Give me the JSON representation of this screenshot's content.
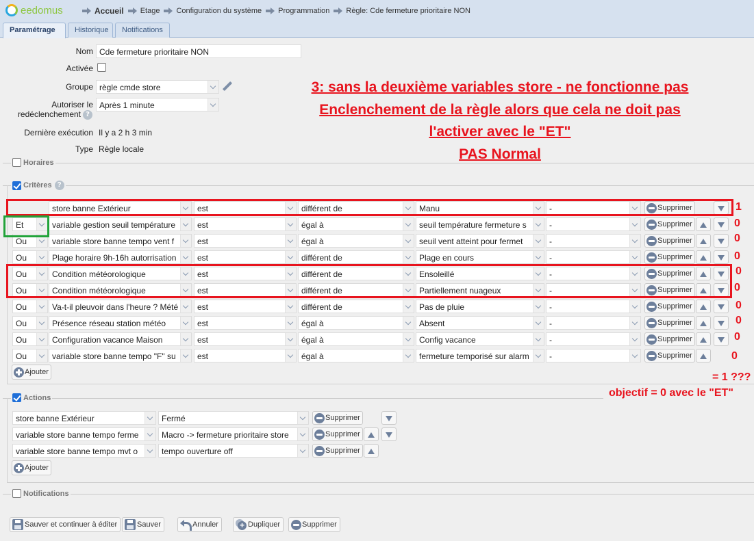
{
  "app": {
    "logo_text": "eedomus"
  },
  "breadcrumb": [
    {
      "label": "Accueil",
      "bold": true
    },
    {
      "label": "Etage"
    },
    {
      "label": "Configuration du système"
    },
    {
      "label": "Programmation"
    },
    {
      "label": "Règle: Cde fermeture prioritaire NON"
    }
  ],
  "tabs": [
    {
      "label": "Paramétrage",
      "active": true
    },
    {
      "label": "Historique"
    },
    {
      "label": "Notifications"
    }
  ],
  "form": {
    "nom_label": "Nom",
    "nom_value": "Cde fermeture prioritaire NON",
    "activee_label": "Activée",
    "activee_checked": false,
    "groupe_label": "Groupe",
    "groupe_value": "règle cmde store",
    "redecl_label_1": "Autoriser le",
    "redecl_label_2": "redéclenchement",
    "redecl_value": "Après 1 minute",
    "derniere_label": "Dernière exécution",
    "derniere_value": "Il y a 2 h 3 min",
    "type_label": "Type",
    "type_value": "Règle locale"
  },
  "sections": {
    "horaires": {
      "label": "Horaires",
      "checked": false
    },
    "criteres": {
      "label": "Critères",
      "checked": true
    },
    "actions": {
      "label": "Actions",
      "checked": true
    },
    "notifications": {
      "label": "Notifications",
      "checked": false
    }
  },
  "criteria": [
    {
      "logic": "",
      "device": "store banne Extérieur",
      "verb": "est",
      "op": "différent de",
      "value": "Manu",
      "extra": "-",
      "up": false,
      "down": true,
      "annotation": "1"
    },
    {
      "logic": "Et",
      "device": "variable gestion seuil température",
      "verb": "est",
      "op": "égal à",
      "value": "seuil température fermeture s",
      "extra": "-",
      "up": true,
      "down": true,
      "annotation": "0"
    },
    {
      "logic": "Ou",
      "device": "variable store banne tempo vent f",
      "verb": "est",
      "op": "égal à",
      "value": "seuil vent atteint pour fermet",
      "extra": "-",
      "up": true,
      "down": true,
      "annotation": "0"
    },
    {
      "logic": "Ou",
      "device": "Plage horaire 9h-16h autorrisation",
      "verb": "est",
      "op": "différent de",
      "value": "Plage en cours",
      "extra": "-",
      "up": true,
      "down": true,
      "annotation": "0"
    },
    {
      "logic": "Ou",
      "device": "Condition météorologique",
      "verb": "est",
      "op": "différent de",
      "value": "Ensoleillé",
      "extra": "-",
      "up": true,
      "down": true,
      "annotation": "0"
    },
    {
      "logic": "Ou",
      "device": "Condition météorologique",
      "verb": "est",
      "op": "différent de",
      "value": "Partiellement nuageux",
      "extra": "-",
      "up": true,
      "down": true,
      "annotation": "0"
    },
    {
      "logic": "Ou",
      "device": "Va-t-il pleuvoir dans l'heure ? Mété",
      "verb": "est",
      "op": "différent de",
      "value": "Pas de pluie",
      "extra": "-",
      "up": true,
      "down": true,
      "annotation": "0"
    },
    {
      "logic": "Ou",
      "device": "Présence réseau station météo",
      "verb": "est",
      "op": "égal à",
      "value": "Absent",
      "extra": "-",
      "up": true,
      "down": true,
      "annotation": "0"
    },
    {
      "logic": "Ou",
      "device": "Configuration vacance Maison",
      "verb": "est",
      "op": "égal à",
      "value": "Config vacance",
      "extra": "-",
      "up": true,
      "down": true,
      "annotation": "0"
    },
    {
      "logic": "Ou",
      "device": "variable store banne tempo \"F\" su",
      "verb": "est",
      "op": "égal à",
      "value": "fermeture temporisé sur alarm",
      "extra": "-",
      "up": true,
      "down": false,
      "annotation": "0"
    }
  ],
  "actions": [
    {
      "device": "store banne Extérieur",
      "value": "Fermé",
      "up": false,
      "down": true
    },
    {
      "device": "variable store banne tempo ferme",
      "value": "Macro -> fermeture prioritaire store",
      "up": true,
      "down": true
    },
    {
      "device": "variable store banne tempo mvt o",
      "value": "tempo ouverture off",
      "up": true,
      "down": false
    }
  ],
  "labels": {
    "delete": "Supprimer",
    "add": "Ajouter"
  },
  "footer_buttons": {
    "save_continue": "Sauver et continuer à éditer",
    "save": "Sauver",
    "cancel": "Annuler",
    "duplicate": "Dupliquer",
    "delete": "Supprimer"
  },
  "annotations": {
    "title_lines": [
      "3: sans la deuxième variables store - ne fonctionne pas",
      "Enclenchement de la règle alors que cela ne doit pas",
      "l'activer avec le \"ET\"",
      "PAS Normal"
    ],
    "result": "= 1 ???",
    "objective": "objectif = 0 avec le \"ET\"",
    "color": "#e8141e",
    "highlight_color": "#22a33a"
  }
}
